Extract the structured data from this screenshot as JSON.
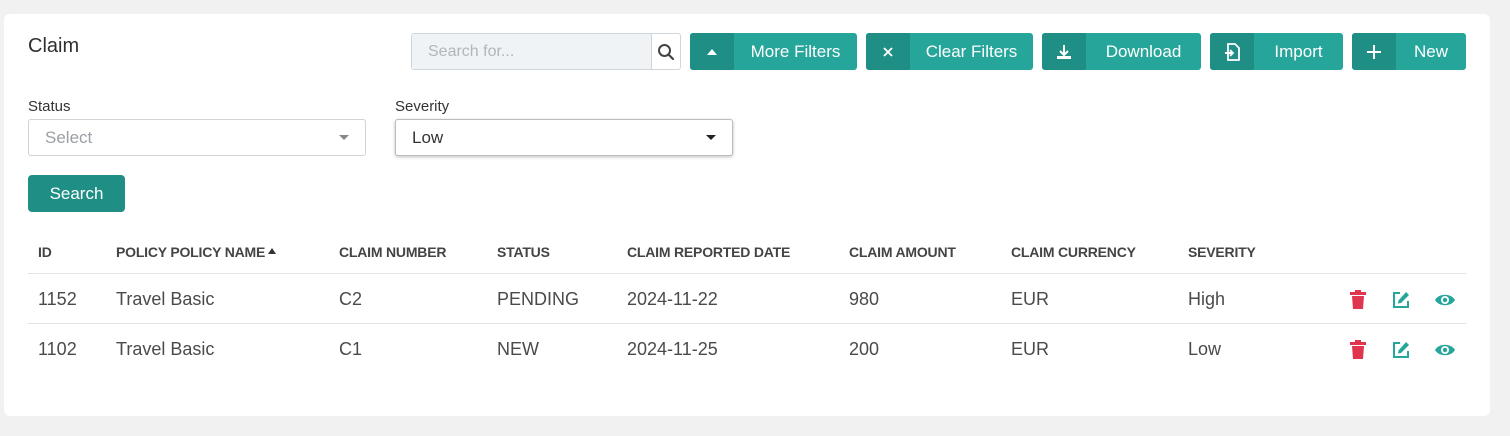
{
  "page_title": "Claim",
  "search": {
    "placeholder": "Search for..."
  },
  "toolbar": {
    "more_filters": "More Filters",
    "clear_filters": "Clear Filters",
    "download": "Download",
    "import": "Import",
    "new": "New"
  },
  "filters": {
    "status": {
      "label": "Status",
      "placeholder": "Select",
      "value": ""
    },
    "severity": {
      "label": "Severity",
      "value": "Low"
    },
    "search_button": "Search"
  },
  "table": {
    "columns": [
      "ID",
      "POLICY POLICY NAME",
      "CLAIM NUMBER",
      "STATUS",
      "CLAIM REPORTED DATE",
      "CLAIM AMOUNT",
      "CLAIM CURRENCY",
      "SEVERITY"
    ],
    "sorted_column": "POLICY POLICY NAME",
    "rows": [
      [
        "1152",
        "Travel Basic",
        "C2",
        "PENDING",
        "2024-11-22",
        "980",
        "EUR",
        "High"
      ],
      [
        "1102",
        "Travel Basic",
        "C1",
        "NEW",
        "2024-11-25",
        "200",
        "EUR",
        "Low"
      ]
    ]
  },
  "colors": {
    "accent": "#26a69a",
    "accent_dark": "#1f8f85",
    "delete": "#e0344f"
  }
}
